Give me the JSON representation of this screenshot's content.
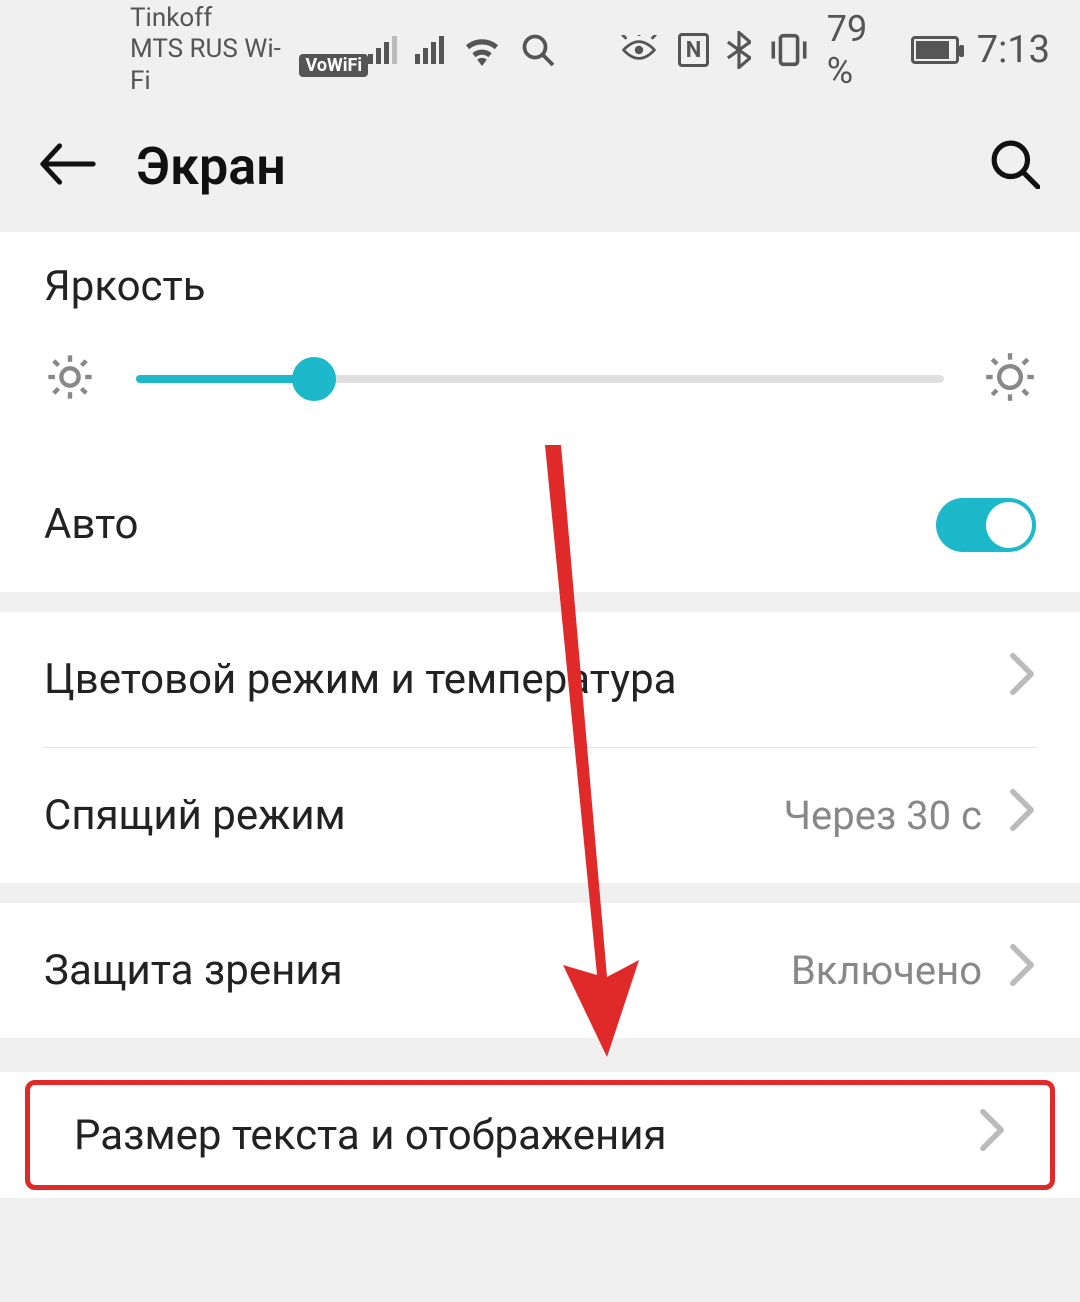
{
  "status": {
    "carrier1": "Tinkoff",
    "carrier2": "MTS RUS Wi-Fi",
    "vowifi": "VoWiFi",
    "nfc": "N",
    "battery_text": "79 %",
    "time": "7:13"
  },
  "header": {
    "title": "Экран"
  },
  "brightness": {
    "label": "Яркость",
    "auto_label": "Авто",
    "percent": 22
  },
  "items": {
    "color_mode": "Цветовой режим и температура",
    "sleep": {
      "label": "Спящий режим",
      "value": "Через 30 с"
    },
    "eye_protect": {
      "label": "Защита зрения",
      "value": "Включено"
    },
    "text_size": "Размер текста и отображения"
  }
}
